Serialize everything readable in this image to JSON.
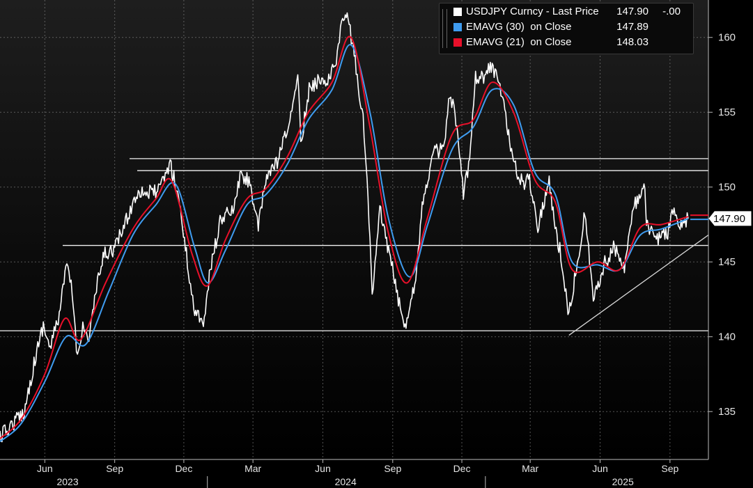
{
  "legend": [
    {
      "name": "USDJPY Curncy - Last Price",
      "value": "147.90",
      "change": "-.00",
      "color": "#ffffff"
    },
    {
      "name": "EMAVG (30)  on Close",
      "value": "147.89",
      "color": "#3f9cf0"
    },
    {
      "name": "EMAVG (21)  on Close",
      "value": "148.03",
      "color": "#e8102a"
    }
  ],
  "chart_data": {
    "type": "line",
    "title": "",
    "ylim": [
      131.8,
      162.5
    ],
    "yticks": [
      135,
      140,
      145,
      150,
      155,
      160
    ],
    "xticks": [
      {
        "label": "Jun",
        "date": "2023-06-01"
      },
      {
        "label": "Sep",
        "date": "2023-09-01"
      },
      {
        "label": "Dec",
        "date": "2023-12-01"
      },
      {
        "label": "Mar",
        "date": "2024-03-01"
      },
      {
        "label": "Jun",
        "date": "2024-06-01"
      },
      {
        "label": "Sep",
        "date": "2024-09-01"
      },
      {
        "label": "Dec",
        "date": "2024-12-01"
      },
      {
        "label": "Mar",
        "date": "2025-03-01"
      },
      {
        "label": "Jun",
        "date": "2025-06-01"
      },
      {
        "label": "Sep",
        "date": "2025-09-01"
      }
    ],
    "years": [
      {
        "label": "2023",
        "date": "2023-07-01"
      },
      {
        "label": "2024",
        "date": "2024-07-01"
      },
      {
        "label": "2025",
        "date": "2025-07-01"
      }
    ],
    "year_separators": [
      "2024-01-01",
      "2025-01-01"
    ],
    "x_range": [
      "2023-04-03",
      "2025-09-25"
    ],
    "grid": true,
    "last_price_label": "147.90",
    "last_price": 147.9,
    "horizontal_lines": [
      151.9,
      151.1,
      146.1,
      140.4
    ],
    "trendline": {
      "from": {
        "date": "2025-04-21",
        "value": 140.1
      },
      "to": {
        "date": "2025-09-25",
        "value": 146.8
      }
    },
    "series": [
      {
        "name": "USDJPY Curncy - Last Price",
        "color": "#ffffff",
        "points": [
          [
            "2023-04-03",
            133.3
          ],
          [
            "2023-04-20",
            134.2
          ],
          [
            "2023-05-05",
            135.0
          ],
          [
            "2023-05-19",
            138.5
          ],
          [
            "2023-05-30",
            140.8
          ],
          [
            "2023-06-08",
            139.2
          ],
          [
            "2023-06-20",
            141.5
          ],
          [
            "2023-06-30",
            144.8
          ],
          [
            "2023-07-07",
            143.0
          ],
          [
            "2023-07-14",
            138.5
          ],
          [
            "2023-07-21",
            141.0
          ],
          [
            "2023-07-28",
            139.6
          ],
          [
            "2023-08-08",
            143.2
          ],
          [
            "2023-08-18",
            145.5
          ],
          [
            "2023-09-01",
            145.9
          ],
          [
            "2023-09-15",
            147.6
          ],
          [
            "2023-10-02",
            149.8
          ],
          [
            "2023-10-16",
            149.6
          ],
          [
            "2023-10-30",
            149.8
          ],
          [
            "2023-11-13",
            151.6
          ],
          [
            "2023-11-24",
            149.4
          ],
          [
            "2023-12-07",
            144.5
          ],
          [
            "2023-12-14",
            141.9
          ],
          [
            "2023-12-28",
            141.0
          ],
          [
            "2024-01-05",
            144.6
          ],
          [
            "2024-01-19",
            147.9
          ],
          [
            "2024-02-05",
            148.5
          ],
          [
            "2024-02-13",
            150.7
          ],
          [
            "2024-02-26",
            150.4
          ],
          [
            "2024-03-08",
            147.2
          ],
          [
            "2024-03-19",
            150.8
          ],
          [
            "2024-04-02",
            151.6
          ],
          [
            "2024-04-12",
            153.3
          ],
          [
            "2024-04-24",
            155.5
          ],
          [
            "2024-04-29",
            158.0
          ],
          [
            "2024-05-03",
            153.0
          ],
          [
            "2024-05-14",
            156.5
          ],
          [
            "2024-05-28",
            157.2
          ],
          [
            "2024-06-10",
            157.2
          ],
          [
            "2024-06-20",
            158.9
          ],
          [
            "2024-06-27",
            161.2
          ],
          [
            "2024-07-03",
            161.5
          ],
          [
            "2024-07-11",
            159.3
          ],
          [
            "2024-07-24",
            154.5
          ],
          [
            "2024-08-02",
            147.0
          ],
          [
            "2024-08-05",
            142.5
          ],
          [
            "2024-08-15",
            148.5
          ],
          [
            "2024-08-29",
            145.2
          ],
          [
            "2024-09-11",
            141.8
          ],
          [
            "2024-09-16",
            140.5
          ],
          [
            "2024-09-30",
            143.6
          ],
          [
            "2024-10-11",
            149.2
          ],
          [
            "2024-10-25",
            152.3
          ],
          [
            "2024-11-08",
            152.6
          ],
          [
            "2024-11-15",
            156.2
          ],
          [
            "2024-11-22",
            154.8
          ],
          [
            "2024-12-03",
            149.6
          ],
          [
            "2024-12-10",
            151.5
          ],
          [
            "2024-12-19",
            157.4
          ],
          [
            "2024-12-31",
            157.4
          ],
          [
            "2025-01-10",
            158.2
          ],
          [
            "2025-01-24",
            156.0
          ],
          [
            "2025-02-07",
            151.5
          ],
          [
            "2025-02-20",
            150.2
          ],
          [
            "2025-02-28",
            150.6
          ],
          [
            "2025-03-11",
            147.4
          ],
          [
            "2025-03-26",
            150.4
          ],
          [
            "2025-04-04",
            146.9
          ],
          [
            "2025-04-09",
            145.8
          ],
          [
            "2025-04-21",
            141.5
          ],
          [
            "2025-05-02",
            145.0
          ],
          [
            "2025-05-12",
            148.3
          ],
          [
            "2025-05-23",
            142.5
          ],
          [
            "2025-06-06",
            144.8
          ],
          [
            "2025-06-20",
            146.0
          ],
          [
            "2025-07-03",
            144.7
          ],
          [
            "2025-07-16",
            148.8
          ],
          [
            "2025-07-30",
            149.8
          ],
          [
            "2025-08-01",
            147.4
          ],
          [
            "2025-08-14",
            146.5
          ],
          [
            "2025-08-29",
            147.0
          ],
          [
            "2025-09-05",
            148.4
          ],
          [
            "2025-09-12",
            147.6
          ],
          [
            "2025-09-18",
            147.3
          ],
          [
            "2025-09-25",
            147.9
          ]
        ]
      },
      {
        "name": "EMAVG (30) on Close",
        "color": "#3f9cf0",
        "points": [
          [
            "2023-04-03",
            133.0
          ],
          [
            "2023-05-01",
            134.2
          ],
          [
            "2023-06-01",
            137.0
          ],
          [
            "2023-06-29",
            140.0
          ],
          [
            "2023-07-25",
            139.5
          ],
          [
            "2023-08-24",
            143.0
          ],
          [
            "2023-09-25",
            146.8
          ],
          [
            "2023-10-25",
            148.8
          ],
          [
            "2023-11-20",
            150.2
          ],
          [
            "2023-12-15",
            146.0
          ],
          [
            "2024-01-02",
            143.6
          ],
          [
            "2024-01-25",
            145.8
          ],
          [
            "2024-02-22",
            148.8
          ],
          [
            "2024-03-18",
            149.5
          ],
          [
            "2024-04-15",
            151.5
          ],
          [
            "2024-05-13",
            154.5
          ],
          [
            "2024-06-13",
            156.5
          ],
          [
            "2024-07-08",
            159.5
          ],
          [
            "2024-08-02",
            155.0
          ],
          [
            "2024-08-26",
            148.0
          ],
          [
            "2024-09-23",
            144.0
          ],
          [
            "2024-10-17",
            147.5
          ],
          [
            "2024-11-18",
            152.5
          ],
          [
            "2024-12-16",
            154.0
          ],
          [
            "2025-01-10",
            156.5
          ],
          [
            "2025-02-07",
            155.5
          ],
          [
            "2025-03-07",
            151.0
          ],
          [
            "2025-04-03",
            149.5
          ],
          [
            "2025-04-25",
            145.0
          ],
          [
            "2025-05-29",
            144.8
          ],
          [
            "2025-06-27",
            144.5
          ],
          [
            "2025-07-24",
            146.8
          ],
          [
            "2025-08-21",
            147.2
          ],
          [
            "2025-09-25",
            147.89
          ]
        ]
      },
      {
        "name": "EMAVG (21) on Close",
        "color": "#e8102a",
        "points": [
          [
            "2023-04-03",
            133.2
          ],
          [
            "2023-05-01",
            134.5
          ],
          [
            "2023-06-01",
            137.5
          ],
          [
            "2023-06-27",
            141.2
          ],
          [
            "2023-07-18",
            139.8
          ],
          [
            "2023-08-20",
            143.6
          ],
          [
            "2023-09-25",
            147.2
          ],
          [
            "2023-10-25",
            149.2
          ],
          [
            "2023-11-15",
            150.4
          ],
          [
            "2023-12-12",
            145.5
          ],
          [
            "2024-01-01",
            143.4
          ],
          [
            "2024-01-25",
            146.5
          ],
          [
            "2024-02-22",
            149.2
          ],
          [
            "2024-03-18",
            149.9
          ],
          [
            "2024-04-15",
            152.0
          ],
          [
            "2024-05-13",
            155.0
          ],
          [
            "2024-06-13",
            157.0
          ],
          [
            "2024-07-08",
            160.0
          ],
          [
            "2024-08-02",
            154.0
          ],
          [
            "2024-08-26",
            147.0
          ],
          [
            "2024-09-20",
            143.6
          ],
          [
            "2024-10-17",
            148.0
          ],
          [
            "2024-11-18",
            153.5
          ],
          [
            "2024-12-16",
            154.5
          ],
          [
            "2025-01-10",
            157.0
          ],
          [
            "2025-02-07",
            155.0
          ],
          [
            "2025-03-07",
            150.5
          ],
          [
            "2025-04-03",
            149.0
          ],
          [
            "2025-04-25",
            144.5
          ],
          [
            "2025-05-29",
            145.0
          ],
          [
            "2025-06-27",
            144.5
          ],
          [
            "2025-07-24",
            147.3
          ],
          [
            "2025-08-21",
            147.5
          ],
          [
            "2025-09-25",
            148.03
          ]
        ]
      }
    ]
  }
}
